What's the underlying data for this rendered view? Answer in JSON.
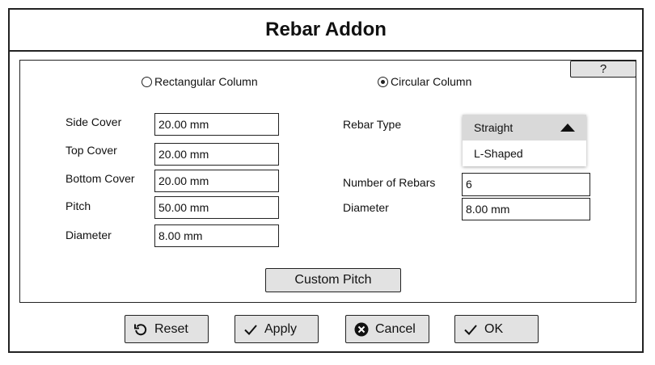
{
  "window": {
    "title": "Rebar Addon"
  },
  "help_label": "?",
  "radios": [
    {
      "label": "Rectangular Column",
      "checked": false
    },
    {
      "label": "Circular Column",
      "checked": true
    }
  ],
  "left_fields": [
    {
      "label": "Side Cover",
      "value": "20.00 mm"
    },
    {
      "label": "Top Cover",
      "value": "20.00 mm"
    },
    {
      "label": "Bottom Cover",
      "value": "20.00 mm"
    },
    {
      "label": "Pitch",
      "value": "50.00 mm"
    },
    {
      "label": "Diameter",
      "value": "8.00 mm"
    }
  ],
  "rebar_type": {
    "label": "Rebar Type",
    "selected": "Straight",
    "options": [
      "L-Shaped"
    ]
  },
  "right_fields": [
    {
      "label": "Number of Rebars",
      "value": "6"
    },
    {
      "label": "Diameter",
      "value": "8.00 mm"
    }
  ],
  "custom_pitch_label": "Custom Pitch",
  "buttons": {
    "reset": "Reset",
    "apply": "Apply",
    "cancel": "Cancel",
    "ok": "OK"
  },
  "icons": {
    "reset": "reset-icon",
    "apply": "check-icon",
    "cancel": "cancel-icon",
    "ok": "check-icon",
    "dropdown": "triangle-up-icon"
  }
}
